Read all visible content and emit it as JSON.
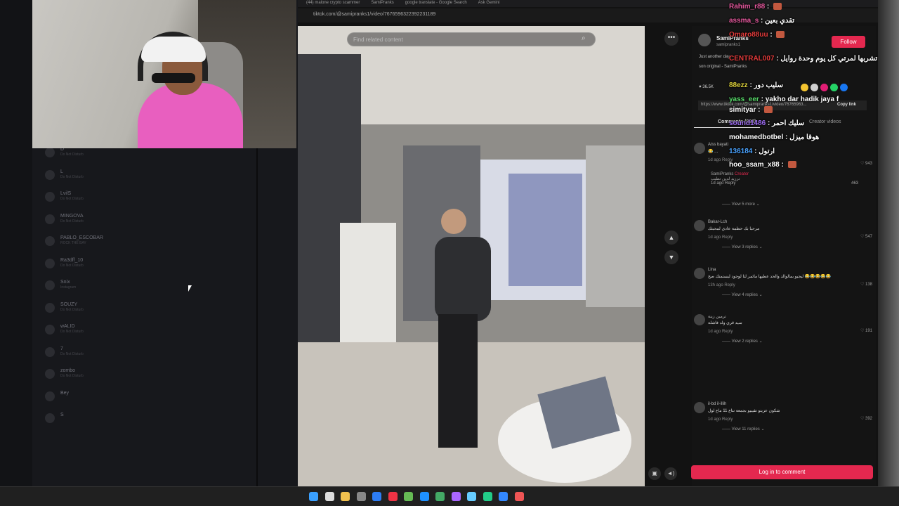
{
  "left_app": {
    "side_names": [
      "",
      "",
      "",
      "",
      "",
      "",
      "",
      "",
      "",
      "",
      "",
      "",
      "",
      "",
      "",
      "",
      "",
      "",
      "",
      "",
      "",
      "",
      "",
      ""
    ],
    "members": [
      {
        "name": "D",
        "status": "Do Not Disturb"
      },
      {
        "name": "L",
        "status": "Do Not Disturb"
      },
      {
        "name": "LvilS",
        "status": "Do Not Disturb"
      },
      {
        "name": "MINGOVA",
        "status": "Do Not Disturb"
      },
      {
        "name": "PABLO_ESCOBAR",
        "status": "ROCK THE BAY"
      },
      {
        "name": "Ra3dff_10",
        "status": "Do Not Disturb"
      },
      {
        "name": "Snix",
        "status": "Instagram"
      },
      {
        "name": "SOUZY",
        "status": "Do Not Disturb"
      },
      {
        "name": "wALID",
        "status": "Do Not Disturb"
      },
      {
        "name": "7",
        "status": "Do Not Disturb"
      },
      {
        "name": "zombo",
        "status": "Do Not Disturb"
      },
      {
        "name": "Bey",
        "status": ""
      },
      {
        "name": "S",
        "status": ""
      }
    ]
  },
  "browser": {
    "tabs": [
      "(44) malone crypto scammer",
      "SamiPranks",
      "google translate - Google Search",
      "Ask Gemini"
    ],
    "url": "tiktok.com/@samipranks1/video/7676596322392231189",
    "search_placeholder": "Find related content",
    "creator_name": "SamiPranks",
    "creator_handle": "samipranks1",
    "follow_label": "Follow",
    "description": "Just another day",
    "sound": "son original - SamiPranks",
    "likes": "36.5K",
    "link": "https://www.tiktok.com/@samipranks1/video/76765963...",
    "copy_link": "Copy link",
    "tab_comments": "Comments (888)",
    "tab_creator_videos": "Creator videos",
    "login_button": "Log in to comment",
    "share_colors": [
      "#f4c430",
      "#cfcfcf",
      "#e11d74",
      "#25d366",
      "#1877f2"
    ]
  },
  "comments": [
    {
      "user": "Aiss bayati",
      "text": "😂 ...",
      "date": "1d ago",
      "reply": "Reply",
      "likes": "943",
      "view": "View 5 more"
    },
    {
      "user": "Bakar-Lch",
      "text": "مرحبا بك حطمة عادي لمحبتك",
      "date": "1d ago",
      "reply": "Reply",
      "likes": "547",
      "view": "View 3 replies"
    },
    {
      "user": "Lina",
      "text": "ليجيو بمالوالد والحد عطيها مائمر لتا لوجود ليستمتك صح 😂😂😂😂😂",
      "date": "13h ago",
      "reply": "Reply",
      "likes": "138",
      "view": "View 4 replies"
    },
    {
      "user": "ترمين زينة",
      "text": "سيد قري ولد فاشلة",
      "date": "1d ago",
      "reply": "Reply",
      "likes": "191",
      "view": "View 2 replies"
    },
    {
      "user": "il-bd il-illih",
      "text": "شكون عزيتو تقيبيو بجمعة نتاع 11 ماع لول",
      "date": "1d ago",
      "reply": "Reply",
      "likes": "392",
      "view": "View 11 replies"
    }
  ],
  "creator_reply": {
    "name": "SamiPranks",
    "badge": "Creator",
    "text": "ترزيد لدين تطيب",
    "date": "1d ago",
    "reply": "Reply",
    "likes": "463"
  },
  "chat": [
    {
      "user": "Rahim_r88",
      "text": "",
      "color": "#e85aa0"
    },
    {
      "user": "assma_s",
      "text": "تقدي بعين",
      "color": "#e85aa0"
    },
    {
      "user": "Omaro88uu",
      "text": "",
      "color": "#e33b3b"
    },
    {
      "user": "CENTRAL007",
      "text": "تشربها لمرتي كل يوم وحدة روايل",
      "color": "#e33b3b"
    },
    {
      "user": "88ezz",
      "text": "سليب دور",
      "color": "#ddd13b"
    },
    {
      "user": "yass_eer",
      "text": "yakho dar hadik jaya f",
      "color": "#58d96a"
    },
    {
      "user": "simityar",
      "text": "",
      "color": "#ffffff"
    },
    {
      "user": "sound1486",
      "text": "سليك احمر",
      "color": "#9d6cf2"
    },
    {
      "user": "mohamedbotbel",
      "text": "هوقا ميزل",
      "color": "#ffffff"
    },
    {
      "user": "136184",
      "text": "ارتول",
      "color": "#4aa3ff"
    },
    {
      "user": "hoo_ssam_x88",
      "text": "",
      "color": "#ffffff"
    }
  ]
}
